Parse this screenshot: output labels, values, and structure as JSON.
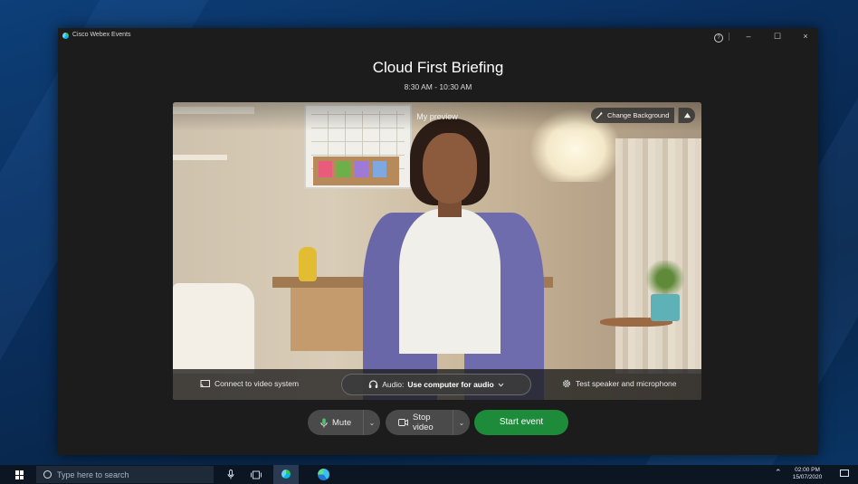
{
  "window": {
    "app_name": "Cisco Webex Events",
    "help_icon": "?",
    "minimize": "–",
    "maximize": "☐",
    "close": "×"
  },
  "event": {
    "title": "Cloud First Briefing",
    "time": "8:30 AM - 10:30 AM"
  },
  "preview": {
    "label": "My preview",
    "change_background": "Change Background",
    "connect_video": "Connect to video system",
    "audio_prefix": "Audio:",
    "audio_value": "Use computer for audio",
    "test_speaker": "Test speaker and microphone"
  },
  "controls": {
    "mute": "Mute",
    "stop_video": "Stop video",
    "start_event": "Start event"
  },
  "taskbar": {
    "search_placeholder": "Type here to search",
    "time": "02:00 PM",
    "date": "15/07/2020"
  },
  "colors": {
    "start_button": "#1d8b3a",
    "window_bg": "#1c1c1c"
  }
}
